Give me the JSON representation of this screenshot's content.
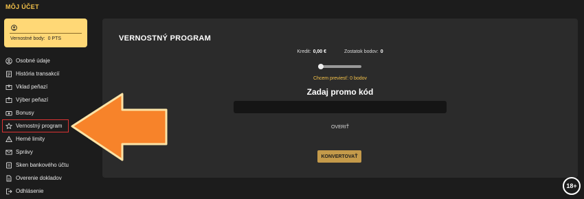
{
  "page": {
    "title": "MÔJ ÚČET"
  },
  "account": {
    "points_label": "Vernostné body:",
    "points_value": "0 PTS"
  },
  "sidebar": {
    "items": [
      {
        "label": "Osobné údaje",
        "icon": "user-circle-icon"
      },
      {
        "label": "História transakcií",
        "icon": "history-icon"
      },
      {
        "label": "Vklad peňazí",
        "icon": "deposit-icon"
      },
      {
        "label": "Výber peňazí",
        "icon": "withdraw-icon"
      },
      {
        "label": "Bonusy",
        "icon": "bonus-icon"
      },
      {
        "label": "Vernostný program",
        "icon": "star-icon",
        "active": true
      },
      {
        "label": "Herné limity",
        "icon": "warning-icon"
      },
      {
        "label": "Správy",
        "icon": "mail-icon"
      },
      {
        "label": "Sken bankového účtu",
        "icon": "scan-icon"
      },
      {
        "label": "Overenie dokladov",
        "icon": "document-icon"
      },
      {
        "label": "Odhlásenie",
        "icon": "logout-icon"
      }
    ]
  },
  "main": {
    "title": "VERNOSTNÝ PROGRAM",
    "credit_label": "Kredit:",
    "credit_value": "0,00 €",
    "points_left_label": "Zostatok bodov:",
    "points_left_value": "0",
    "slider_level": 0,
    "convert_hint": "Chcem previesť: 0 bodov",
    "promo_title": "Zadaj promo kód",
    "promo_value": "",
    "verify_label": "OVERIŤ",
    "convert_label": "KONVERTOVAŤ"
  },
  "badge": {
    "age": "18+"
  },
  "colors": {
    "accent": "#f6c34a",
    "card": "#ffd876",
    "panel": "#2b2b2b",
    "arrow": "#f7832a",
    "highlight": "#dd3333"
  }
}
